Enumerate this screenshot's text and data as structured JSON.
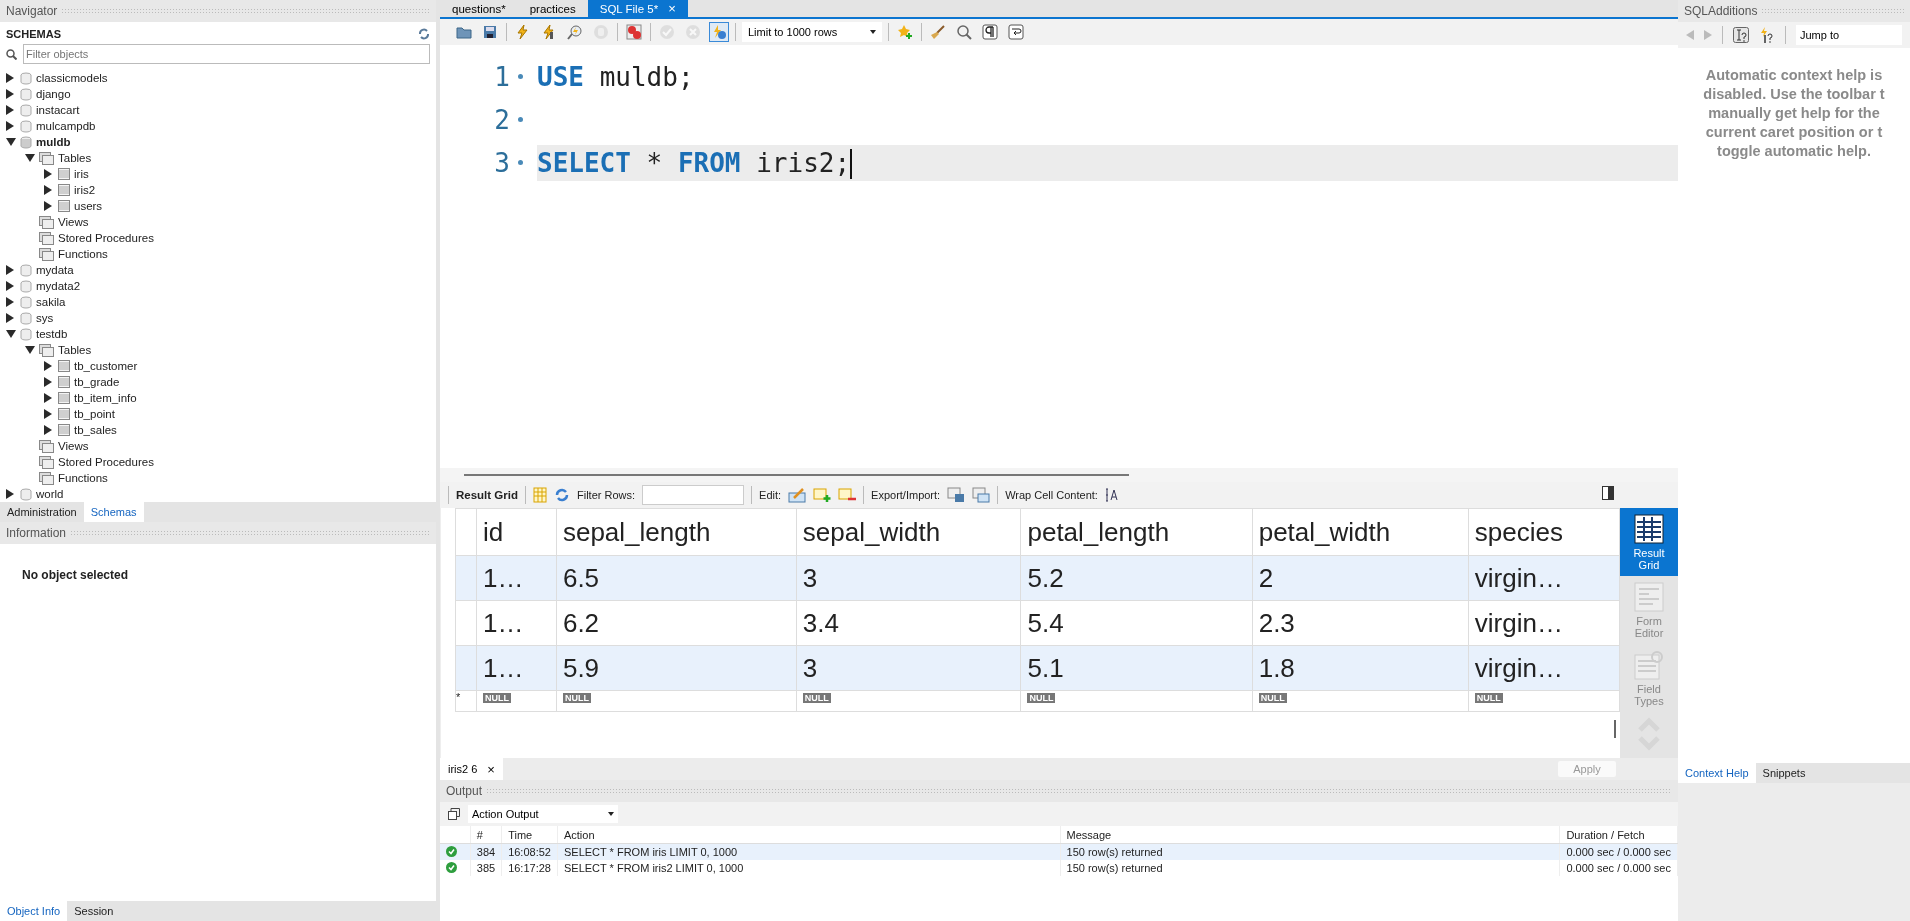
{
  "navigator": {
    "title": "Navigator",
    "section": "SCHEMAS",
    "filter": {
      "placeholder": "Filter objects"
    },
    "tree": [
      {
        "label": "classicmodels",
        "kind": "schema",
        "expandable": true,
        "expanded": false,
        "default": false
      },
      {
        "label": "django",
        "kind": "schema",
        "expandable": true,
        "expanded": false,
        "default": false
      },
      {
        "label": "instacart",
        "kind": "schema",
        "expandable": true,
        "expanded": false,
        "default": false
      },
      {
        "label": "mulcampdb",
        "kind": "schema",
        "expandable": true,
        "expanded": false,
        "default": false
      },
      {
        "label": "muldb",
        "kind": "schema",
        "expandable": true,
        "expanded": true,
        "default": true,
        "children": [
          {
            "label": "Tables",
            "kind": "folder",
            "expandable": true,
            "expanded": true,
            "default": false,
            "children": [
              {
                "label": "iris",
                "kind": "table",
                "expandable": true,
                "expanded": false,
                "default": false
              },
              {
                "label": "iris2",
                "kind": "table",
                "expandable": true,
                "expanded": false,
                "default": false
              },
              {
                "label": "users",
                "kind": "table",
                "expandable": true,
                "expanded": false,
                "default": false
              }
            ]
          },
          {
            "label": "Views",
            "kind": "folder",
            "expandable": false,
            "default": false
          },
          {
            "label": "Stored Procedures",
            "kind": "folder",
            "expandable": false,
            "default": false
          },
          {
            "label": "Functions",
            "kind": "folder",
            "expandable": false,
            "default": false
          }
        ]
      },
      {
        "label": "mydata",
        "kind": "schema",
        "expandable": true,
        "expanded": false,
        "default": false
      },
      {
        "label": "mydata2",
        "kind": "schema",
        "expandable": true,
        "expanded": false,
        "default": false
      },
      {
        "label": "sakila",
        "kind": "schema",
        "expandable": true,
        "expanded": false,
        "default": false
      },
      {
        "label": "sys",
        "kind": "schema",
        "expandable": true,
        "expanded": false,
        "default": false
      },
      {
        "label": "testdb",
        "kind": "schema",
        "expandable": true,
        "expanded": true,
        "default": false,
        "children": [
          {
            "label": "Tables",
            "kind": "folder",
            "expandable": true,
            "expanded": true,
            "default": false,
            "children": [
              {
                "label": "tb_customer",
                "kind": "table",
                "expandable": true,
                "expanded": false,
                "default": false
              },
              {
                "label": "tb_grade",
                "kind": "table",
                "expandable": true,
                "expanded": false,
                "default": false
              },
              {
                "label": "tb_item_info",
                "kind": "table",
                "expandable": true,
                "expanded": false,
                "default": false
              },
              {
                "label": "tb_point",
                "kind": "table",
                "expandable": true,
                "expanded": false,
                "default": false
              },
              {
                "label": "tb_sales",
                "kind": "table",
                "expandable": true,
                "expanded": false,
                "default": false
              }
            ]
          },
          {
            "label": "Views",
            "kind": "folder",
            "expandable": false,
            "default": false
          },
          {
            "label": "Stored Procedures",
            "kind": "folder",
            "expandable": false,
            "default": false
          },
          {
            "label": "Functions",
            "kind": "folder",
            "expandable": false,
            "default": false
          }
        ]
      },
      {
        "label": "world",
        "kind": "schema",
        "expandable": true,
        "expanded": false,
        "default": false
      }
    ],
    "tabs": [
      {
        "label": "Administration",
        "selected": false
      },
      {
        "label": "Schemas",
        "selected": true
      }
    ]
  },
  "information": {
    "title": "Information",
    "message": "No object selected",
    "tabs": [
      {
        "label": "Object Info",
        "selected": true
      },
      {
        "label": "Session",
        "selected": false
      }
    ]
  },
  "editor_tabs": [
    {
      "label": "questions*",
      "selected": false
    },
    {
      "label": "practices",
      "selected": false
    },
    {
      "label": "SQL File 5*",
      "selected": true,
      "close": "×"
    }
  ],
  "editor_toolbar": [
    {
      "kind": "folder",
      "disabled": false,
      "on": false
    },
    {
      "kind": "floppy",
      "disabled": false,
      "on": false
    },
    {
      "kind": "separator"
    },
    {
      "kind": "bolt",
      "disabled": false,
      "on": false
    },
    {
      "kind": "bolt_cursor",
      "disabled": false,
      "on": false
    },
    {
      "kind": "magnifier_bolt",
      "disabled": false,
      "on": false
    },
    {
      "kind": "hand",
      "disabled": true,
      "on": false
    },
    {
      "kind": "separator"
    },
    {
      "kind": "stop_error",
      "disabled": false,
      "on": false
    },
    {
      "kind": "separator"
    },
    {
      "kind": "check",
      "disabled": true,
      "on": false
    },
    {
      "kind": "cancel",
      "disabled": true,
      "on": false
    },
    {
      "kind": "autocommit",
      "disabled": false,
      "on": true
    },
    {
      "kind": "separator"
    },
    {
      "kind": "limit",
      "value": "Limit to 1000 rows"
    },
    {
      "kind": "separator"
    },
    {
      "kind": "star_plus",
      "disabled": false,
      "on": false
    },
    {
      "kind": "separator"
    },
    {
      "kind": "broom",
      "disabled": false,
      "on": false
    },
    {
      "kind": "magnifier",
      "disabled": false,
      "on": false
    },
    {
      "kind": "pilcrow",
      "disabled": false,
      "on": false
    },
    {
      "kind": "wrap",
      "disabled": false,
      "on": false
    }
  ],
  "editor_lines": [
    {
      "number": "1",
      "current": false,
      "tokens": [
        {
          "text": "USE",
          "kind": "keyword"
        },
        {
          "text": "muldb;",
          "kind": "plain"
        }
      ]
    },
    {
      "number": "2",
      "current": false
    },
    {
      "number": "3",
      "current": true,
      "tokens": [
        {
          "text": "SELECT",
          "kind": "keyword"
        },
        {
          "text": "*",
          "kind": "plain"
        },
        {
          "text": "FROM",
          "kind": "keyword"
        },
        {
          "text": "iris2;",
          "kind": "plain"
        }
      ]
    }
  ],
  "result_toolbar": {
    "title": "Result Grid",
    "filter_label": "Filter Rows:",
    "edit_label": "Edit:",
    "export_label": "Export/Import:",
    "wrap_label": "Wrap Cell Content:"
  },
  "grid": {
    "columns": [
      "id",
      "sepal_length",
      "sepal_width",
      "petal_length",
      "petal_width",
      "species"
    ],
    "rows": [
      [
        "1…",
        "6.5",
        "3",
        "5.2",
        "2",
        "virgin…"
      ],
      [
        "1…",
        "6.2",
        "3.4",
        "5.4",
        "2.3",
        "virgin…"
      ],
      [
        "1…",
        "5.9",
        "3",
        "5.1",
        "1.8",
        "virgin…"
      ]
    ],
    "new_row": {
      "marker": "*",
      "cells": [
        "NULL",
        "NULL",
        "NULL",
        "NULL",
        "NULL",
        "NULL"
      ]
    }
  },
  "result_side": [
    {
      "label": "Result Grid",
      "kind": "grid",
      "selected": true
    },
    {
      "label": "Form Editor",
      "kind": "form",
      "selected": false
    },
    {
      "label": "Field Types",
      "kind": "types",
      "selected": false
    }
  ],
  "result_tabs": [
    {
      "label": "iris2 6",
      "close": "×",
      "selected": true
    }
  ],
  "apply": {
    "label": "Apply",
    "disabled": true
  },
  "output": {
    "title": "Output",
    "selector": "Action Output",
    "columns": [
      "#",
      "Time",
      "Action",
      "Message",
      "Duration / Fetch"
    ],
    "rows": [
      {
        "kind": "success",
        "number": "384",
        "time": "16:08:52",
        "action": "SELECT * FROM iris LIMIT 0, 1000",
        "message": "150 row(s) returned",
        "duration": "0.000 sec / 0.000 sec",
        "selected": true
      },
      {
        "kind": "success",
        "number": "385",
        "time": "16:17:28",
        "action": "SELECT * FROM iris2 LIMIT 0, 1000",
        "message": "150 row(s) returned",
        "duration": "0.000 sec / 0.000 sec",
        "selected": false
      }
    ]
  },
  "sql_additions": {
    "title": "SQLAdditions",
    "jump": "Jump to",
    "help": [
      "Automatic context help is",
      "disabled. Use the toolbar t",
      "manually get help for the",
      "current caret position or t",
      "toggle automatic help."
    ],
    "tabs": [
      {
        "label": "Context Help",
        "selected": true
      },
      {
        "label": "Snippets",
        "selected": false
      }
    ]
  }
}
